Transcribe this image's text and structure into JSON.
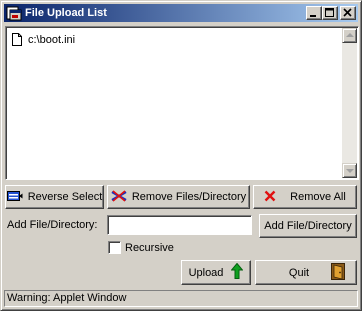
{
  "window": {
    "title": "File Upload List",
    "titlebar_buttons": {
      "minimize": "_",
      "maximize": "□",
      "close": "×"
    }
  },
  "file_list": {
    "items": [
      {
        "icon": "document-icon",
        "label": "c:\\boot.ini"
      }
    ]
  },
  "actions": {
    "reverse_select": "Reverse Select",
    "remove_files": "Remove Files/Directory",
    "remove_all": "Remove All"
  },
  "add_row": {
    "label": "Add File/Directory:",
    "input_value": "",
    "button": "Add File/Directory"
  },
  "recursive": {
    "label": "Recursive",
    "checked": false
  },
  "bottom": {
    "upload": "Upload",
    "quit": "Quit"
  },
  "status": "Warning: Applet Window",
  "colors": {
    "title_start": "#0a246a",
    "title_end": "#a6caf0",
    "face": "#d4d0c8",
    "remove_red": "#e01010",
    "upload_green": "#10a020",
    "quit_door": "#c07820"
  }
}
